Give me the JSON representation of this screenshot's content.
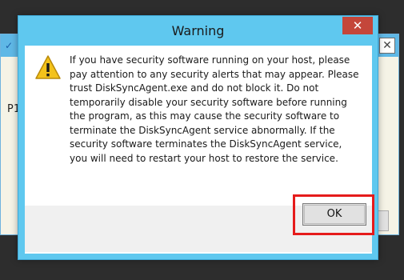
{
  "background_window": {
    "app_icon": "app-icon",
    "close_label": "✕",
    "partial_text": "P1"
  },
  "dialog": {
    "title": "Warning",
    "close_label": "✕",
    "icon": "warning-icon",
    "message": "If you have security software running on your host, please pay attention to any security alerts that may appear. Please trust DiskSyncAgent.exe and do not block it. Do not temporarily disable your security software before running the program, as this may cause the security software to terminate the DiskSyncAgent service abnormally. If the security software terminates the DiskSyncAgent service, you will need to restart your host to restore the service.",
    "ok_label": "OK"
  },
  "colors": {
    "title_bar": "#5fc8ef",
    "close_button": "#c4463a",
    "highlight": "#e51b1b",
    "warning_yellow": "#f3c21b"
  }
}
